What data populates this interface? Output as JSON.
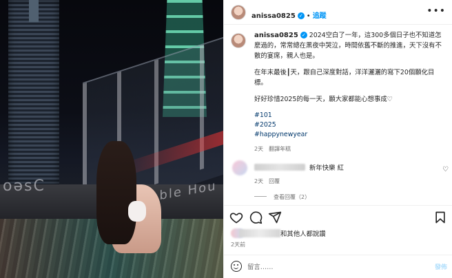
{
  "post": {
    "username": "anissa0825",
    "follow_label": "追蹤",
    "separator": "•",
    "more_label": "•••"
  },
  "caption": {
    "paragraph1": "2024空白了一年，這300多個日子也不知道怎麼過的，常常總在黑夜中哭泣，時間依舊不斷的推進，天下沒有不散的宴席，親人也是。",
    "paragraph2": "在年末最後┃天，跟自己深度對話，洋洋灑灑的寫下20個願化目標。",
    "paragraph3": "好好珍惜2025的每一天，願大家都能心想事成♡",
    "hashtags": [
      "#101",
      "#2025",
      "#happynewyear"
    ],
    "time": "2天",
    "translate_label": "翻譯年糕"
  },
  "comment": {
    "text": "新年快樂 紅",
    "time": "2天",
    "reply_label": "回覆",
    "view_replies": "查看回覆（2）"
  },
  "likes": {
    "text": "和其他人都說讚",
    "time": "2天前"
  },
  "add_comment": {
    "placeholder": "留言……",
    "post_label": "發佈"
  },
  "photo": {
    "neon_left": "oəsC",
    "neon_right": "nble Hou"
  },
  "colors": {
    "link": "#0095f6",
    "hashtag": "#00376b",
    "muted": "#737373"
  }
}
